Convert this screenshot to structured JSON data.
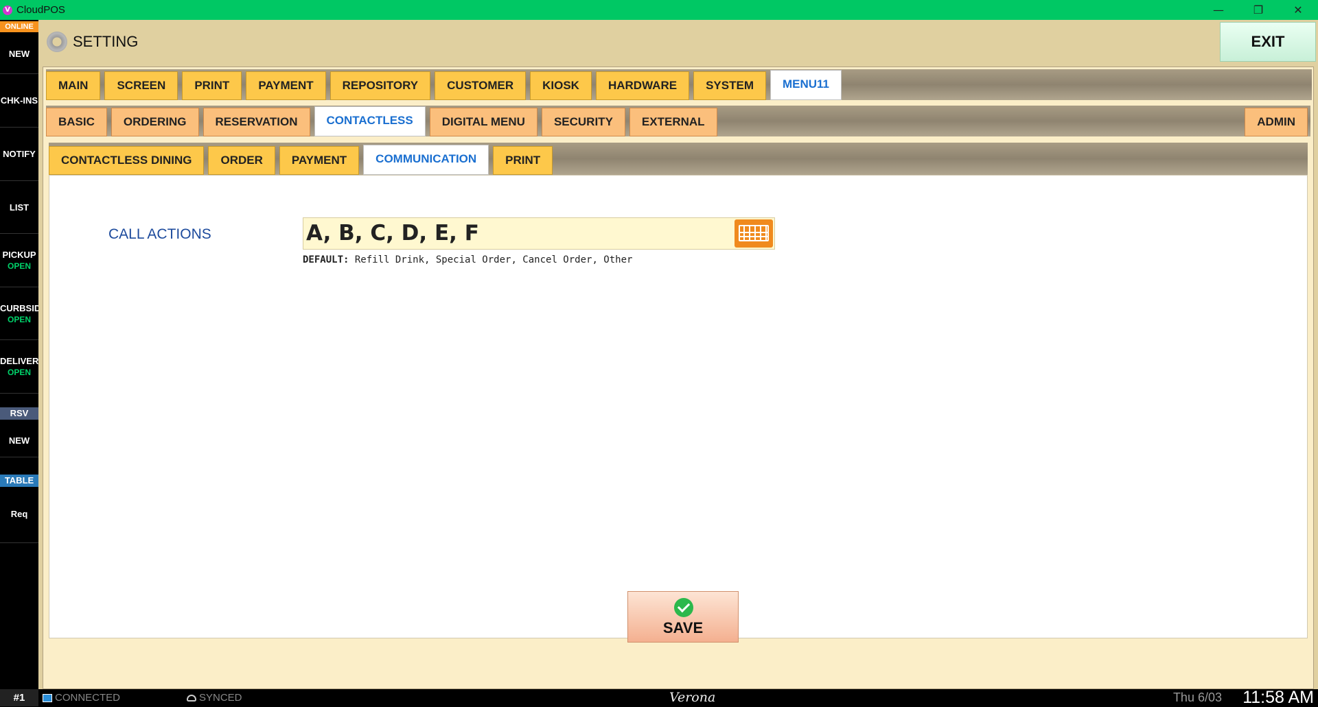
{
  "window": {
    "app_icon": "V",
    "title": "CloudPOS",
    "minimize": "—",
    "restore": "❐",
    "close": "✕"
  },
  "sidebar": {
    "status_badge": "ONLINE",
    "items": [
      {
        "label": "NEW",
        "sub": ""
      },
      {
        "label": "CHK-INS",
        "sub": ""
      },
      {
        "label": "NOTIFY",
        "sub": ""
      },
      {
        "label": "LIST",
        "sub": ""
      },
      {
        "label": "PICKUP",
        "sub": "OPEN"
      },
      {
        "label": "CURBSID",
        "sub": "OPEN"
      },
      {
        "label": "DELIVER",
        "sub": "OPEN"
      }
    ],
    "rsv_label": "RSV",
    "rsv_new": "NEW",
    "table_label": "TABLE",
    "req_label": "Req"
  },
  "header": {
    "title": "SETTING",
    "exit_label": "EXIT"
  },
  "tabs_level1": [
    "MAIN",
    "SCREEN",
    "PRINT",
    "PAYMENT",
    "REPOSITORY",
    "CUSTOMER",
    "KIOSK",
    "HARDWARE",
    "SYSTEM",
    "MENU11"
  ],
  "tabs_level2": [
    "BASIC",
    "ORDERING",
    "RESERVATION",
    "CONTACTLESS",
    "DIGITAL MENU",
    "SECURITY",
    "EXTERNAL"
  ],
  "tabs_level2_right": "ADMIN",
  "tabs_level3": [
    "CONTACTLESS DINING",
    "ORDER",
    "PAYMENT",
    "COMMUNICATION",
    "PRINT"
  ],
  "content": {
    "call_actions_label": "CALL ACTIONS",
    "call_actions_value": "A, B, C, D, E, F",
    "default_prefix": "DEFAULT:",
    "default_value": "Refill Drink, Special Order, Cancel Order, Other",
    "save_label": "SAVE"
  },
  "status": {
    "station": "#1",
    "connection": "CONNECTED",
    "sync": "SYNCED",
    "store": "Verona",
    "date": "Thu 6/03",
    "time": "11:58 AM"
  },
  "colors": {
    "titlebar": "#00c864",
    "tab_yellow": "#fdc84a",
    "tab_orange": "#fbbf7c",
    "active_tab_text": "#1a6fd0",
    "accent_green": "#00d26a",
    "badge_orange": "#f7931e"
  }
}
